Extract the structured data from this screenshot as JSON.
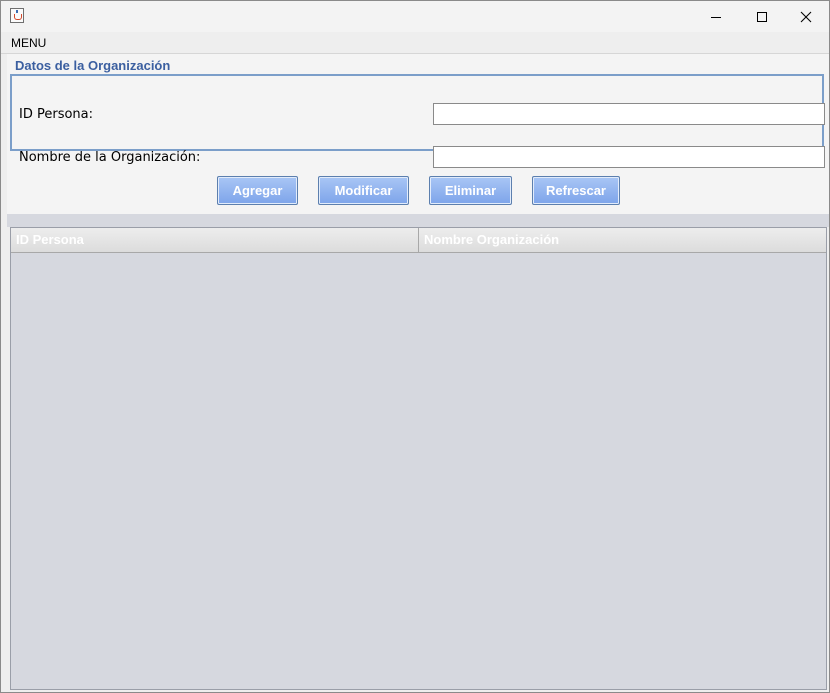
{
  "window": {
    "controls": [
      "minimize-icon",
      "maximize-icon",
      "close-icon"
    ]
  },
  "menu": {
    "items": [
      "MENU"
    ]
  },
  "form": {
    "legend": "Datos de la Organización",
    "fields": [
      {
        "label": "ID Persona:",
        "value": ""
      },
      {
        "label": "Nombre de la Organización:",
        "value": ""
      }
    ]
  },
  "actions": {
    "agregar": "Agregar",
    "modificar": "Modificar",
    "eliminar": "Eliminar",
    "refrescar": "Refrescar"
  },
  "table": {
    "columns": [
      "ID Persona",
      "Nombre Organización"
    ],
    "rows": []
  },
  "colors": {
    "accent": "#3b5fa0",
    "button": "#7da4ea",
    "table_bg": "#d6d8df"
  }
}
